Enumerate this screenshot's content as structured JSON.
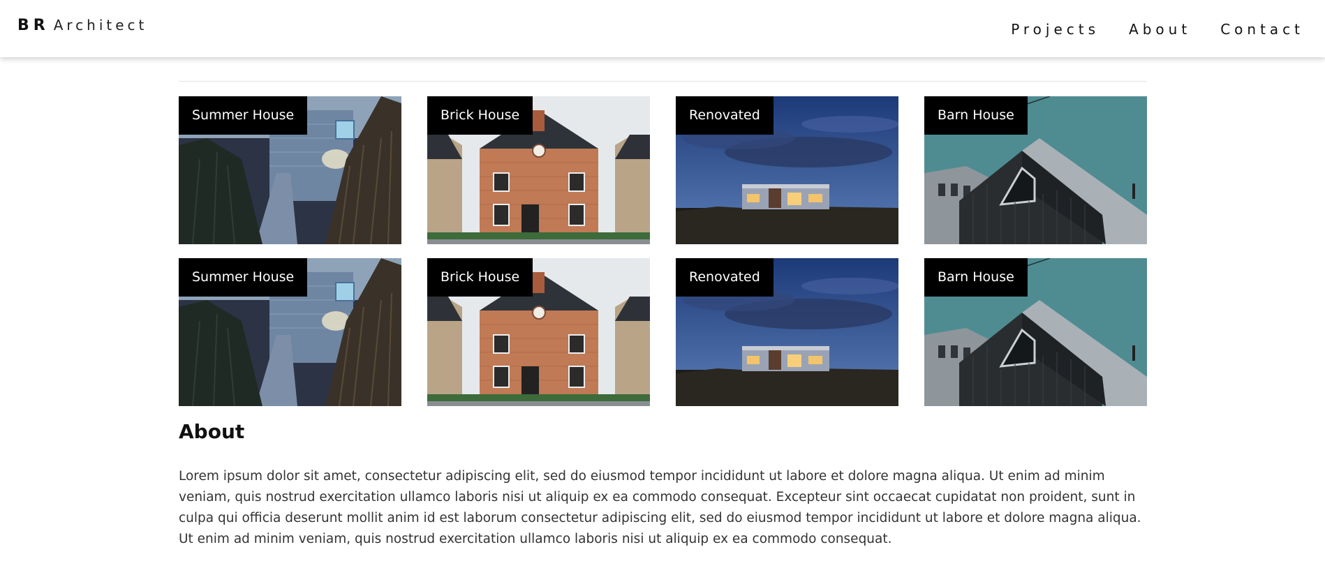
{
  "header": {
    "brand_initials": "BR",
    "brand_name": "Architect",
    "nav": [
      {
        "label": "Projects"
      },
      {
        "label": "About"
      },
      {
        "label": "Contact"
      }
    ]
  },
  "projects": [
    {
      "label": "Summer House",
      "icon": "summer-house-photo"
    },
    {
      "label": "Brick House",
      "icon": "brick-house-photo"
    },
    {
      "label": "Renovated",
      "icon": "renovated-house-photo"
    },
    {
      "label": "Barn House",
      "icon": "barn-house-photo"
    },
    {
      "label": "Summer House",
      "icon": "summer-house-photo"
    },
    {
      "label": "Brick House",
      "icon": "brick-house-photo"
    },
    {
      "label": "Renovated",
      "icon": "renovated-house-photo"
    },
    {
      "label": "Barn House",
      "icon": "barn-house-photo"
    }
  ],
  "about": {
    "title": "About",
    "text": "Lorem ipsum dolor sit amet, consectetur adipiscing elit, sed do eiusmod tempor incididunt ut labore et dolore magna aliqua. Ut enim ad minim veniam, quis nostrud exercitation ullamco laboris nisi ut aliquip ex ea commodo consequat. Excepteur sint occaecat cupidatat non proident, sunt in culpa qui officia deserunt mollit anim id est laborum consectetur adipiscing elit, sed do eiusmod tempor incididunt ut labore et dolore magna aliqua. Ut enim ad minim veniam, quis nostrud exercitation ullamco laboris nisi ut aliquip ex ea commodo consequat."
  },
  "colors": {
    "tag_background": "#000000",
    "tag_text": "#ffffff",
    "body_text": "#333333"
  }
}
